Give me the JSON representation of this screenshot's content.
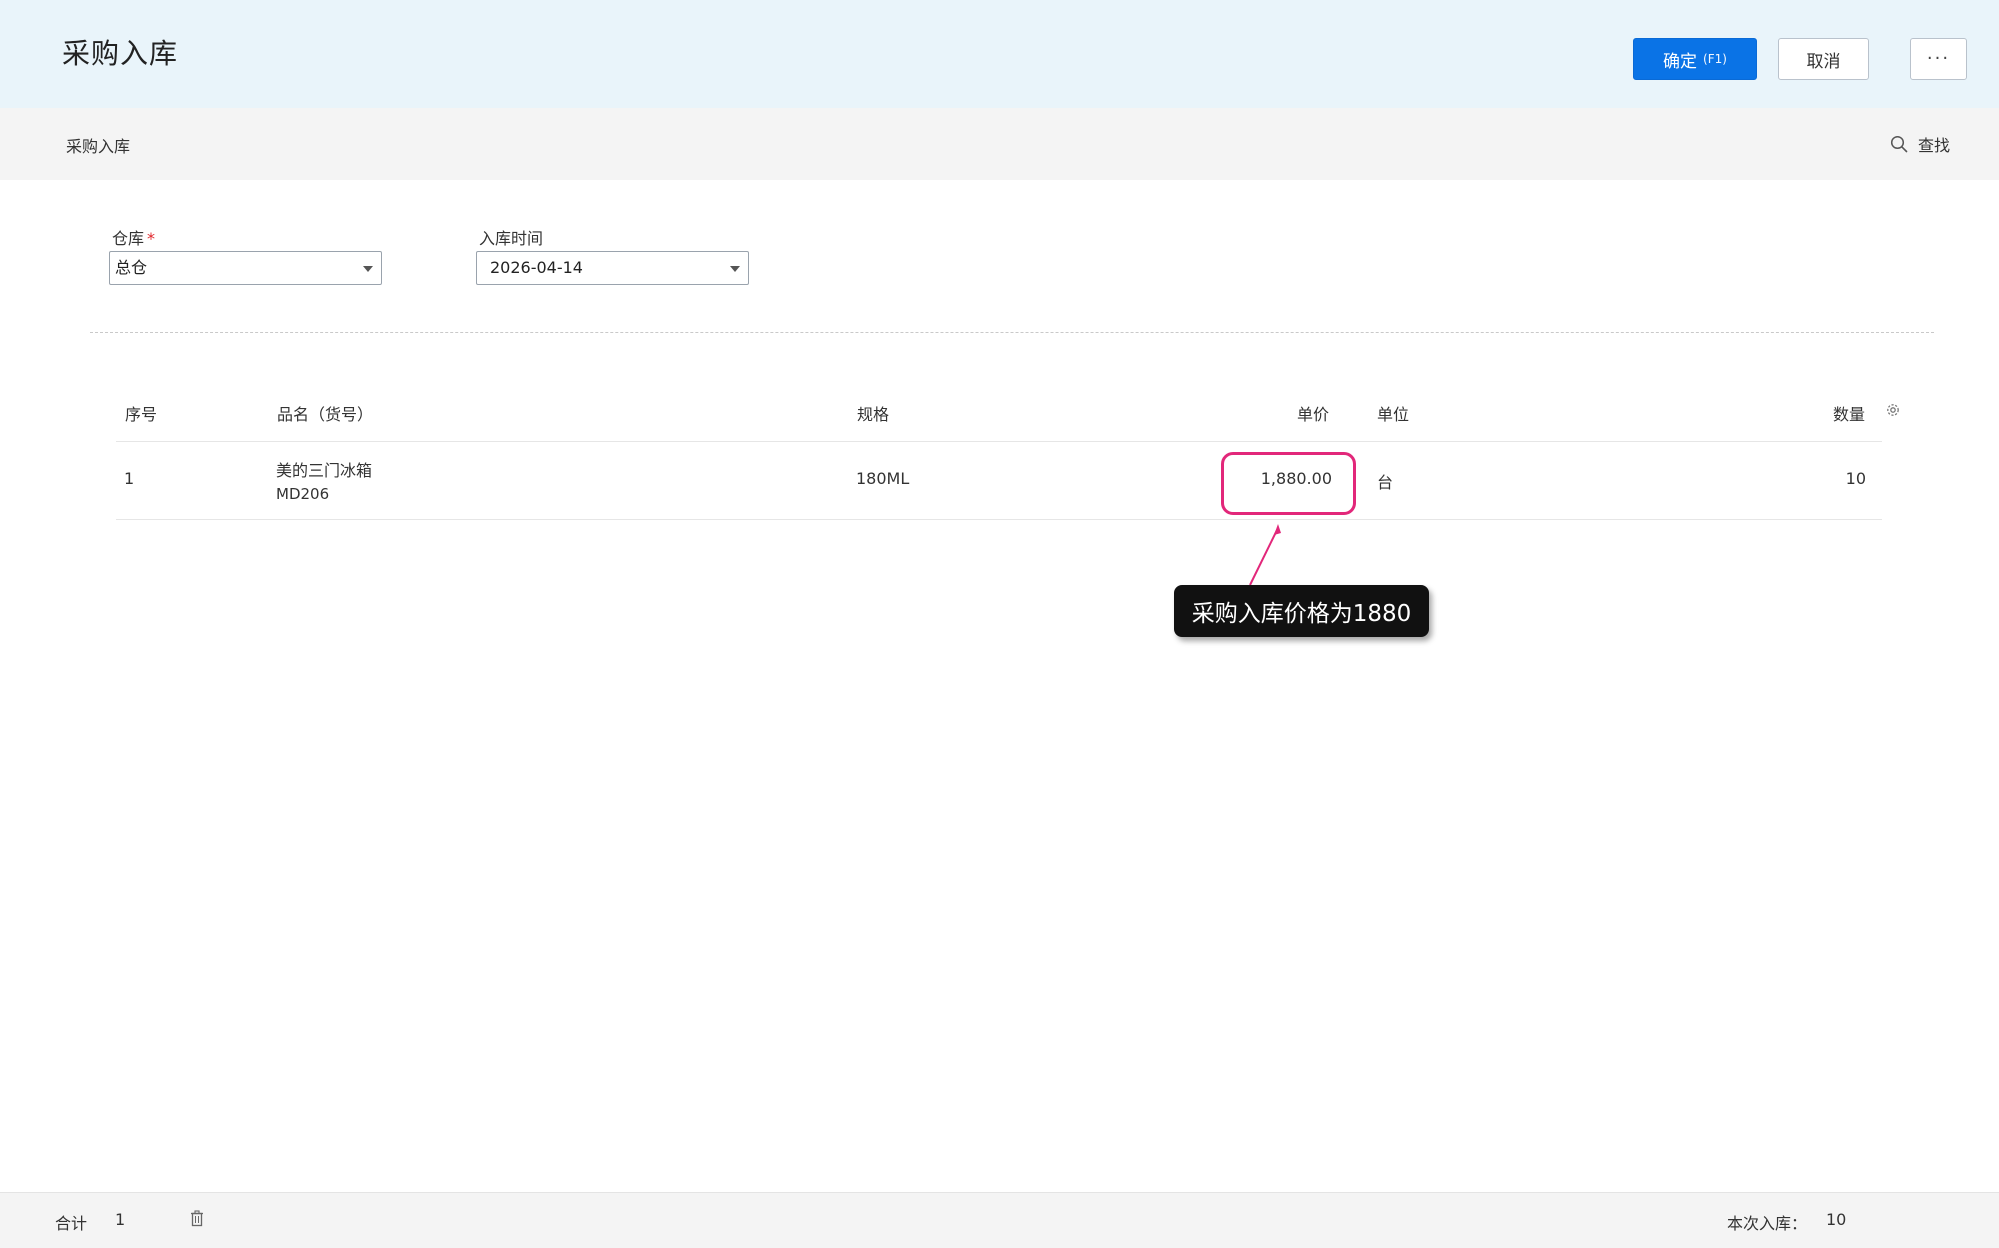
{
  "header": {
    "title": "采购入库",
    "confirm_label": "确定",
    "confirm_shortcut": "(F1)",
    "cancel_label": "取消",
    "more_label": "···"
  },
  "toolbar": {
    "breadcrumb": "采购入库",
    "search_label": "查找"
  },
  "form": {
    "warehouse_label": "仓库",
    "warehouse_required_mark": "*",
    "warehouse_value": "总仓",
    "date_label": "入库时间",
    "date_value": "2026-04-14"
  },
  "table": {
    "headers": {
      "seq": "序号",
      "name": "品名（货号）",
      "spec": "规格",
      "price": "单价",
      "unit": "单位",
      "qty": "数量"
    },
    "rows": [
      {
        "seq": "1",
        "name": "美的三门冰箱",
        "code": "MD206",
        "spec": "180ML",
        "price": "1,880.00",
        "unit": "台",
        "qty": "10"
      }
    ]
  },
  "annotation": {
    "text": "采购入库价格为1880",
    "color": "#e2277a"
  },
  "footer": {
    "total_label": "合计",
    "total_value": "1",
    "inbound_label": "本次入库：",
    "inbound_value": "10"
  },
  "colors": {
    "primary": "#0a73e6",
    "header_bg": "#e9f4fa",
    "required": "#e0262b"
  }
}
